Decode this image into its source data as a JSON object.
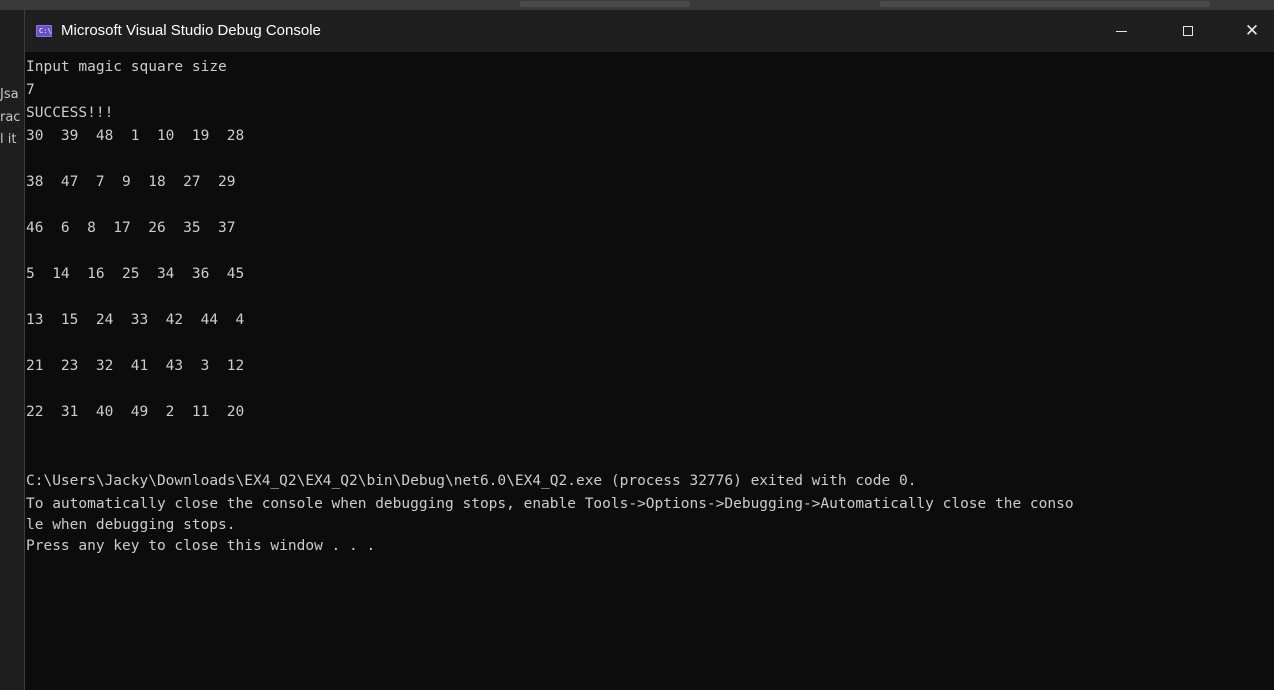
{
  "window": {
    "title": "Microsoft Visual Studio Debug Console",
    "icon_label": "C:\\",
    "controls": {
      "minimize": "minimize",
      "maximize": "maximize",
      "close": "✕"
    }
  },
  "background_window": {
    "left_clipped_text": [
      "Jsa",
      "rac",
      "l it"
    ]
  },
  "console": {
    "lines": [
      "Input magic square size",
      "7",
      "SUCCESS!!!",
      "30  39  48  1  10  19  28",
      "",
      "38  47  7  9  18  27  29",
      "",
      "46  6  8  17  26  35  37",
      "",
      "5  14  16  25  34  36  45",
      "",
      "13  15  24  33  42  44  4",
      "",
      "21  23  32  41  43  3  12",
      "",
      "22  31  40  49  2  11  20",
      "",
      "",
      "C:\\Users\\Jacky\\Downloads\\EX4_Q2\\EX4_Q2\\bin\\Debug\\net6.0\\EX4_Q2.exe (process 32776) exited with code 0.",
      "To automatically close the console when debugging stops, enable Tools->Options->Debugging->Automatically close the conso",
      "le when debugging stops.",
      "Press any key to close this window . . ."
    ]
  },
  "colors": {
    "console_bg": "#0c0c0c",
    "console_text": "#cccccc",
    "title_bar_bg": "#1f1f1f",
    "title_text": "#ffffff",
    "icon_accent": "#6a4fc8"
  }
}
